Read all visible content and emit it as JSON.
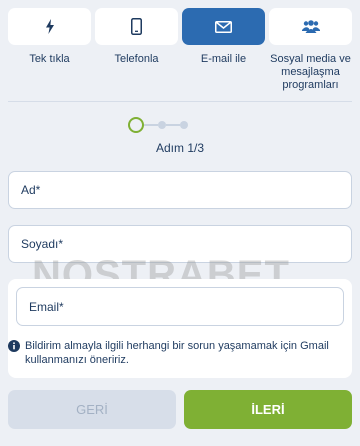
{
  "tabs": [
    {
      "label": "Tek tıkla",
      "icon": "lightning-icon",
      "active": false
    },
    {
      "label": "Telefonla",
      "icon": "phone-icon",
      "active": false
    },
    {
      "label": "E-mail ile",
      "icon": "envelope-icon",
      "active": true
    },
    {
      "label": "Sosyal media ve mesajlaşma programları",
      "icon": "users-icon",
      "active": false
    }
  ],
  "stepper": {
    "text": "Adım 1/3",
    "current": 1,
    "total": 3
  },
  "form": {
    "name_placeholder": "Ad*",
    "surname_placeholder": "Soyadı*",
    "email_placeholder": "Email*",
    "info_text": "Bildirim almayla ilgili herhangi bir sorun yaşamamak için Gmail kullanmanızı öneririz."
  },
  "watermark": "NOSTRABET",
  "buttons": {
    "back": "GERİ",
    "next": "İLERİ"
  },
  "colors": {
    "background": "#edf0f5",
    "active_tab": "#2c6bb1",
    "accent_green": "#7fb034",
    "text": "#1e3a5f",
    "disabled_button": "#d7dee9"
  }
}
